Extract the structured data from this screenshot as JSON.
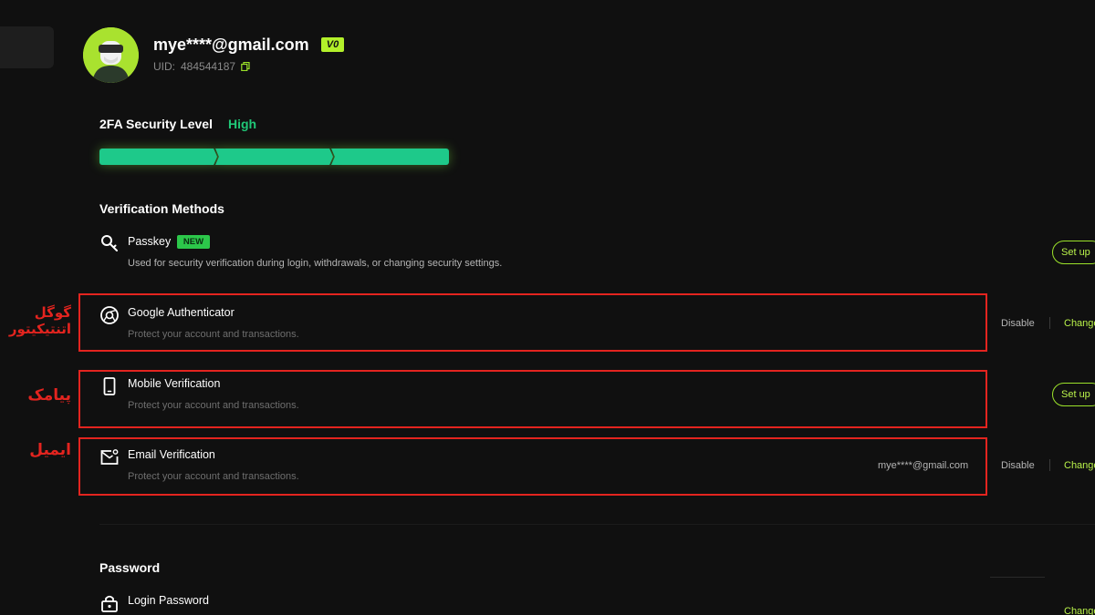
{
  "profile": {
    "email": "mye****@gmail.com",
    "vip_badge": "V0",
    "uid_label": "UID:",
    "uid_value": "484544187"
  },
  "security": {
    "title": "2FA Security Level",
    "level": "High",
    "progress_filled_segments": 3,
    "progress_total_segments": 3,
    "level_color": "#20c777"
  },
  "verification": {
    "title": "Verification Methods",
    "passkey": {
      "name": "Passkey",
      "badge": "NEW",
      "desc": "Used for security verification during login, withdrawals, or changing security settings.",
      "action": "Set up"
    },
    "google": {
      "name": "Google Authenticator",
      "desc": "Protect your account and transactions.",
      "disable": "Disable",
      "change": "Change"
    },
    "mobile": {
      "name": "Mobile Verification",
      "desc": "Protect your account and transactions.",
      "action": "Set up"
    },
    "email": {
      "name": "Email Verification",
      "desc": "Protect your account and transactions.",
      "value": "mye****@gmail.com",
      "disable": "Disable",
      "change": "Change"
    }
  },
  "annotations": {
    "google_line1": "گوگل",
    "google_line2": "اتنتیکیتور",
    "mobile": "پیامک",
    "email": "ایمیل",
    "color": "#e3241f"
  },
  "password": {
    "title": "Password",
    "login": {
      "name": "Login Password",
      "change": "Change"
    }
  },
  "colors": {
    "accent": "#b9f24a",
    "background": "#101010"
  }
}
